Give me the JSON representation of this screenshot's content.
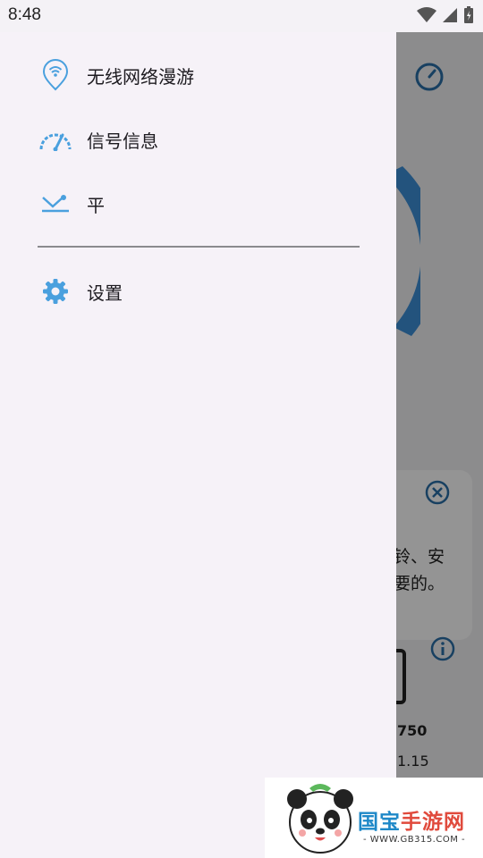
{
  "status_bar": {
    "time": "8:48"
  },
  "drawer": {
    "items": [
      {
        "label": "无线网络漫游",
        "icon": "wifi-location-icon"
      },
      {
        "label": "信号信息",
        "icon": "speedometer-icon"
      },
      {
        "label": "平",
        "icon": "level-icon"
      },
      {
        "label": "设置",
        "icon": "gear-icon"
      }
    ]
  },
  "background": {
    "tip_text": "铃、安\n要的。",
    "value_1": "750",
    "value_2": "1.15"
  },
  "watermark": {
    "brand_part1": "国宝",
    "brand_part2": "手游网",
    "url": "- WWW.GB315.COM -"
  },
  "colors": {
    "accent": "#4aa0de",
    "drawer_bg": "#f6f2f8",
    "app_accent": "#2a6fa8"
  }
}
